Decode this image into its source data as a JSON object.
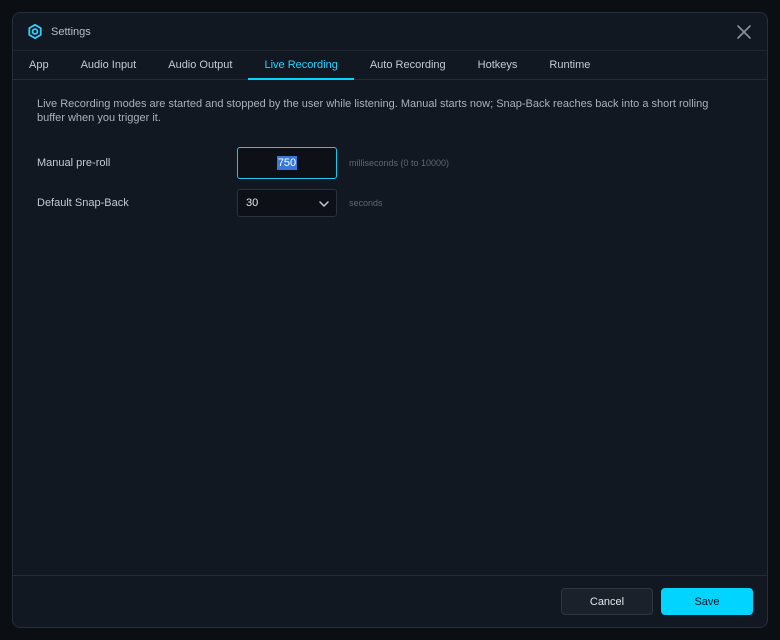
{
  "window": {
    "title": "Settings"
  },
  "tabs": [
    {
      "label": "App"
    },
    {
      "label": "Audio Input"
    },
    {
      "label": "Audio Output"
    },
    {
      "label": "Live Recording",
      "active": true
    },
    {
      "label": "Auto Recording"
    },
    {
      "label": "Hotkeys"
    },
    {
      "label": "Runtime"
    }
  ],
  "live_recording": {
    "description": "Live Recording modes are started and stopped by the user while listening. Manual starts now; Snap-Back reaches back into a short rolling buffer when you trigger it.",
    "manual_preroll": {
      "label": "Manual pre-roll",
      "value": "750",
      "hint": "milliseconds (0 to 10000)"
    },
    "default_snapback": {
      "label": "Default Snap-Back",
      "value": "30",
      "hint": "seconds"
    }
  },
  "footer": {
    "cancel_label": "Cancel",
    "save_label": "Save"
  },
  "colors": {
    "accent": "#00d4ff",
    "background": "#121821"
  },
  "icons": {
    "title": "gear-icon",
    "close": "close-icon",
    "select": "chevron-down-icon"
  }
}
